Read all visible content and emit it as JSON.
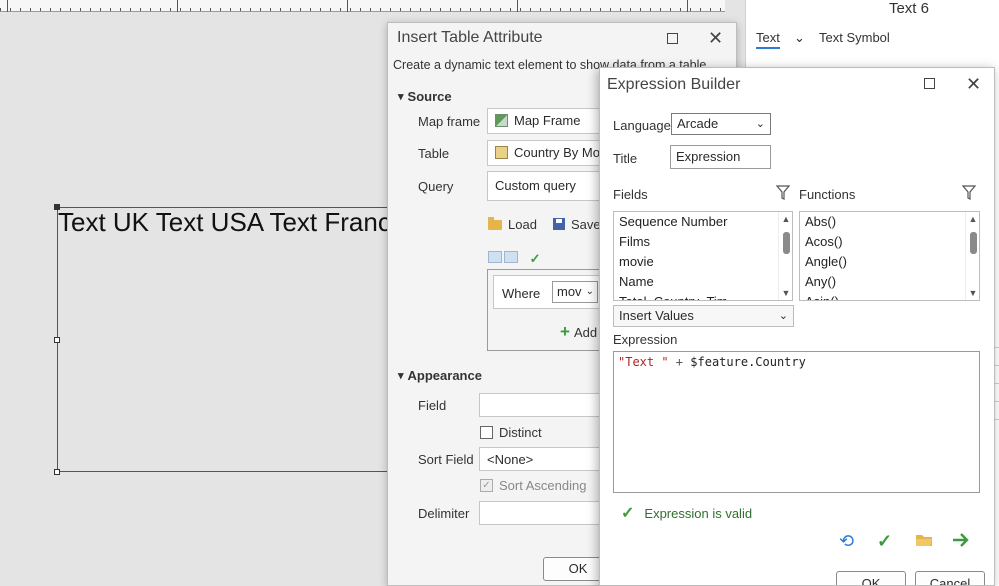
{
  "layout_canvas": {
    "text_element": "Text UK Text USA Text France Te"
  },
  "side_pane": {
    "title": "Text 6",
    "tabs": [
      "Text",
      "Text Symbol"
    ]
  },
  "insert_table_attribute": {
    "title": "Insert Table Attribute",
    "description": "Create a dynamic text element to show data from a table.",
    "source_section": "Source",
    "map_frame_label": "Map frame",
    "map_frame_value": "Map Frame",
    "table_label": "Table",
    "table_value": "Country By Mov",
    "query_label": "Query",
    "query_value": "Custom query",
    "load_label": "Load",
    "save_label": "Save",
    "where_label": "Where",
    "where_field": "mov",
    "add_label": "Add",
    "appearance_section": "Appearance",
    "field_label": "Field",
    "field_value": "",
    "distinct_label": "Distinct",
    "sort_field_label": "Sort Field",
    "sort_field_value": "<None>",
    "sort_ascending_label": "Sort Ascending",
    "delimiter_label": "Delimiter",
    "delimiter_value": "",
    "ok_label": "OK"
  },
  "expression_builder": {
    "title": "Expression Builder",
    "language_label": "Language",
    "language_value": "Arcade",
    "title_label": "Title",
    "title_value": "Expression",
    "fields_label": "Fields",
    "fields": [
      "Sequence Number",
      "Films",
      "movie",
      "Name",
      "Total_Country_Tim"
    ],
    "functions_label": "Functions",
    "functions": [
      "Abs()",
      "Acos()",
      "Angle()",
      "Any()",
      "Asin()"
    ],
    "insert_values_label": "Insert Values",
    "expression_label": "Expression",
    "expression_string": "\"Text \"",
    "expression_operator": " + ",
    "expression_variable": "$feature.Country",
    "valid_message": "Expression is valid",
    "ok_label": "OK",
    "cancel_label": "Cancel"
  },
  "colors": {
    "accent_blue": "#2c7bd6",
    "valid_green": "#3d9a3d",
    "string_red": "#b22222"
  }
}
